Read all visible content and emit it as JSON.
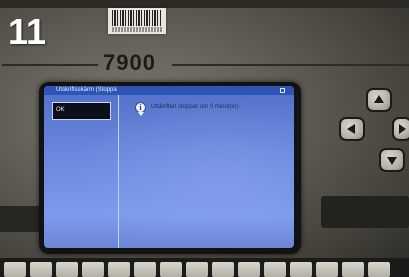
{
  "photo": {
    "step_number": "11",
    "model_label": "7900"
  },
  "screen": {
    "title": "Utskriftsskärm (Stoppa",
    "ok_label": "OK",
    "message": "Utskriften stoppar om 0 minut(er)",
    "info_icon": "info-speech-bubble-icon"
  },
  "keypad": {
    "arrows": [
      "up-arrow-icon",
      "left-arrow-icon",
      "right-arrow-icon",
      "down-arrow-icon"
    ]
  },
  "colors": {
    "screen_blue": "#6b89de",
    "titlebar_blue": "#2f55b4",
    "step_number_white": "#ffffff"
  }
}
